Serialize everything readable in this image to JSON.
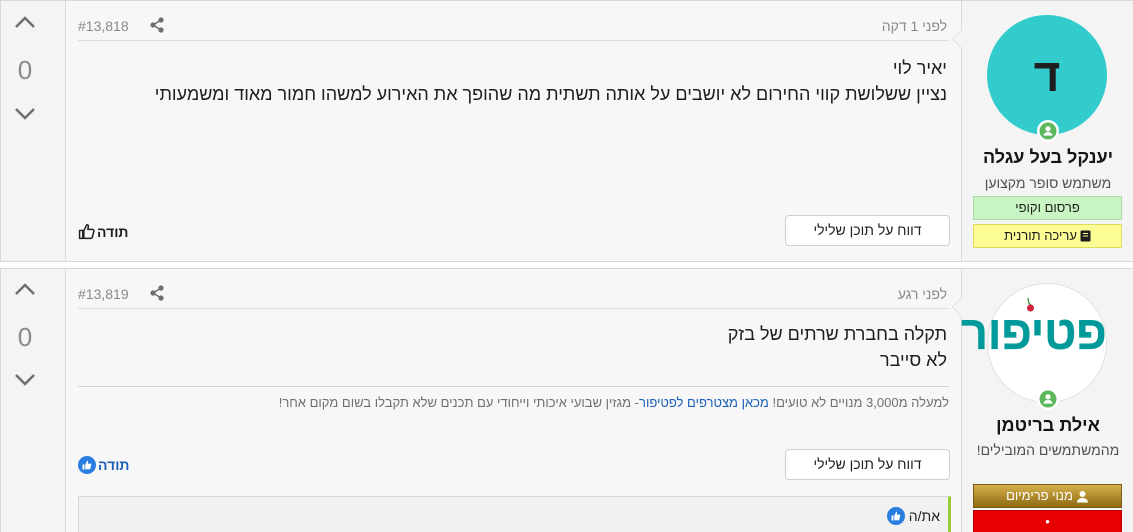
{
  "posts": [
    {
      "number": "#13,818",
      "time": "לפני 1 דקה",
      "votes": "0",
      "lines": [
        "יאיר לוי",
        "נציין ששלושת קווי החירום לא יושבים על אותה תשתית מה שהופך את האירוע למשהו חמור מאוד ומשמעותי"
      ],
      "report_label": "דווח על תוכן שלילי",
      "thanks_label": "תודה",
      "author": {
        "avatar_letter": "ד",
        "name": "יענקל בעל עגלה",
        "title": "משתמש סופר מקצוען",
        "badges": [
          "פרסום וקופי",
          "עריכה תורנית"
        ]
      }
    },
    {
      "number": "#13,819",
      "time": "לפני רגע",
      "votes": "0",
      "lines": [
        "תקלה בחברת שרתים של בזק",
        "לא סייבר"
      ],
      "signature": {
        "before": "למעלה מ3,000 מנויים לא טועים! ",
        "link": "מכאן מצטרפים לפטיפור",
        "after": "- מגזין שבועי איכותי וייחודי עם תכנים שלא תקבלו בשום מקום אחר!"
      },
      "report_label": "דווח על תוכן שלילי",
      "thanks_label": "תודה",
      "quote_label": "את/ה",
      "author": {
        "logo_text": "פטיפור",
        "name": "אילת בריטמן",
        "title": "מהמשתמשים המובילים!",
        "badges": [
          "מנוי פרימיום",
          "•"
        ]
      }
    }
  ],
  "colors": {
    "accent_blue": "#1a60b8",
    "online_green": "#5cb85c",
    "avatar_teal": "#33cccc",
    "logo_teal": "#009a9a"
  },
  "icons": {
    "upvote": "chevron-up-icon",
    "downvote": "chevron-down-icon",
    "share": "share-icon",
    "thumbs_up": "thumbs-up-icon",
    "online": "online-user-icon",
    "book": "book-icon",
    "user": "user-icon"
  }
}
